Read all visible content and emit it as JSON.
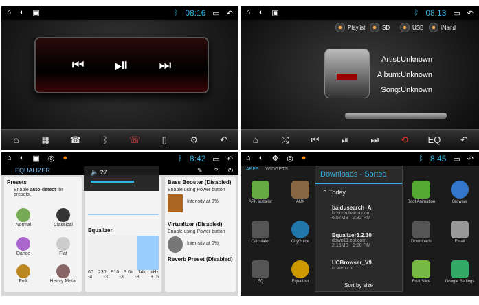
{
  "q1": {
    "clock": "08:16"
  },
  "q2": {
    "clock": "08:13",
    "sources": [
      "Playlist",
      "SD",
      "USB",
      "iNand"
    ],
    "artist": "Artist:Unknown",
    "album": "Album:Unknown",
    "song": "Song:Unknown",
    "eq_label": "EQ"
  },
  "q3": {
    "clock": "8:42",
    "title": "EQUALIZER",
    "volume": "27",
    "presets_title": "Presets",
    "autodetect_prefix": "Enable ",
    "autodetect_bold": "auto-detect",
    "autodetect_suffix": " for presets.",
    "presets": [
      "Normal",
      "Classical",
      "Dance",
      "Flat",
      "Folk",
      "Heavy Metal"
    ],
    "equalizer_title": "Equalizer",
    "eq_values": [
      "60",
      "230",
      "910",
      "3.6k",
      "14k",
      "kHz"
    ],
    "eq_gains": [
      "-4",
      "-3",
      "-3",
      "-8",
      "+15"
    ],
    "bass_title": "Bass Booster (Disabled)",
    "bass_desc": "Enable using Power button",
    "bass_intensity": "Intensity at 0%",
    "virt_title": "Virtualizer (Disabled)",
    "virt_desc": "Enable using Power button",
    "virt_intensity": "Intensity at 0%",
    "reverb_title": "Reverb Preset (Disabled)"
  },
  "q4": {
    "clock": "8:45",
    "tabs": [
      "APPS",
      "WIDGETS"
    ],
    "apps": [
      "APK installer",
      "AUX",
      "Calculator",
      "CityGuide",
      "EQ",
      "Equalizer",
      "Boot Animation",
      "Browser",
      "Downloads",
      "Email",
      "Fruit Slice",
      "Google Settings"
    ],
    "dialog_title": "Downloads - Sorted",
    "section": "Today",
    "downloads": [
      {
        "name": "baidusearch_A",
        "src": "bcscdn.baidu.com",
        "size": "6.57MB",
        "time": "2:32 PM"
      },
      {
        "name": "Equalizer3.2.10",
        "src": "down11.zol.com.",
        "size": "2.15MB",
        "time": "2:28 PM"
      },
      {
        "name": "UCBrowser_V9.",
        "src": "ucweb.cn",
        "size": "",
        "time": ""
      }
    ],
    "sort": "Sort by size"
  }
}
